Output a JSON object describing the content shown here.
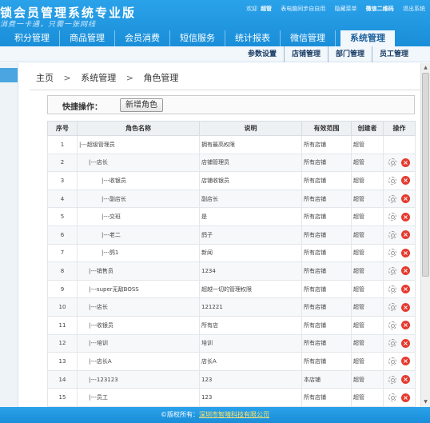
{
  "header": {
    "title": "锁会员管理系统专业版",
    "slogan": "消费一卡通，只需一张网线",
    "top_links": {
      "welcome": "欢迎",
      "user": "超管",
      "note": "表电脑同步自自用",
      "exit": "隐藏菜单",
      "qr": "微信二维码",
      "logout": "退出系统"
    }
  },
  "mainnav": {
    "items": [
      {
        "label": "积分管理"
      },
      {
        "label": "商品管理"
      },
      {
        "label": "会员消费"
      },
      {
        "label": "短信服务"
      },
      {
        "label": "统计报表"
      },
      {
        "label": "微信管理"
      },
      {
        "label": "系统管理"
      }
    ]
  },
  "subnav": {
    "items": [
      {
        "label": "参数设置"
      },
      {
        "label": "店铺管理"
      },
      {
        "label": "部门管理"
      },
      {
        "label": "员工管理"
      }
    ]
  },
  "breadcrumb": {
    "home": "主页",
    "sep1": ">",
    "level1": "系统管理",
    "sep2": ">",
    "current": "角色管理"
  },
  "quick": {
    "label": "快捷操作：",
    "add_button": "新增角色"
  },
  "table": {
    "headers": {
      "no": "序号",
      "name": "角色名称",
      "desc": "说明",
      "scope": "有效范围",
      "creator": "创建者",
      "ops": "操作"
    },
    "rows": [
      {
        "no": "1",
        "name": "|---超级管理员",
        "desc": "拥有最高权限",
        "scope": "所有店铺",
        "creator": "超管"
      },
      {
        "no": "2",
        "name": "|---店长",
        "desc": "店铺管理员",
        "scope": "所有店铺",
        "creator": "超管"
      },
      {
        "no": "3",
        "name": "|---收银员",
        "desc": "店铺收银员",
        "scope": "所有店铺",
        "creator": "超管"
      },
      {
        "no": "4",
        "name": "|---副店长",
        "desc": "副店长",
        "scope": "所有店铺",
        "creator": "超管"
      },
      {
        "no": "5",
        "name": "|---交班",
        "desc": "是",
        "scope": "所有店铺",
        "creator": "超管"
      },
      {
        "no": "6",
        "name": "|---老二",
        "desc": "鸽子",
        "scope": "所有店铺",
        "creator": "超管"
      },
      {
        "no": "7",
        "name": "|---鸽1",
        "desc": "新闻",
        "scope": "所有店铺",
        "creator": "超管"
      },
      {
        "no": "8",
        "name": "|---销售员",
        "desc": "1234",
        "scope": "所有店铺",
        "creator": "超管"
      },
      {
        "no": "9",
        "name": "|---super无敌BOSS",
        "desc": "超越一切的管理权限",
        "scope": "所有店铺",
        "creator": "超管"
      },
      {
        "no": "10",
        "name": "|---店长",
        "desc": "121221",
        "scope": "所有店铺",
        "creator": "超管"
      },
      {
        "no": "11",
        "name": "|---收银员",
        "desc": "所有店",
        "scope": "所有店铺",
        "creator": "超管"
      },
      {
        "no": "12",
        "name": "|---培训",
        "desc": "培训",
        "scope": "所有店铺",
        "creator": "超管"
      },
      {
        "no": "13",
        "name": "|---店长A",
        "desc": "店长A",
        "scope": "所有店铺",
        "creator": "超管"
      },
      {
        "no": "14",
        "name": "|---123123",
        "desc": "123",
        "scope": "本店铺",
        "creator": "超管"
      },
      {
        "no": "15",
        "name": "|---员工",
        "desc": "123",
        "scope": "所有店铺",
        "creator": "超管"
      }
    ]
  },
  "footer": {
    "prefix": "©版权所有：",
    "company": "深圳市智晴科技有限公司"
  },
  "colors": {
    "header_blue": "#1a8ed8",
    "delete_red": "#e43a2f"
  }
}
